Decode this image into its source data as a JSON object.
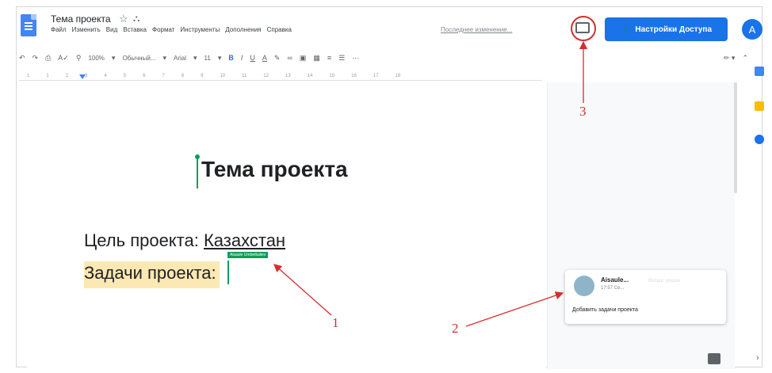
{
  "header": {
    "doc_title": "Тема проекта",
    "menu": [
      "Файл",
      "Изменить",
      "Вид",
      "Вставка",
      "Формат",
      "Инструменты",
      "Дополнения",
      "Справка"
    ],
    "last_edit": "Последнее изменение...",
    "share_label": "Настройки Доступа",
    "avatar_initial": "A"
  },
  "toolbar": {
    "zoom": "100%",
    "style": "Обычный...",
    "font": "Arial",
    "size": "11"
  },
  "ruler": [
    "1",
    "1",
    "2",
    "3",
    "4",
    "5",
    "6",
    "7",
    "8",
    "9",
    "10",
    "11",
    "12",
    "13",
    "14",
    "15",
    "16",
    "17",
    "18"
  ],
  "document": {
    "heading": "Тема проекта",
    "line1_prefix": "Цель проекта: ",
    "line1_word": "Казахстан",
    "line2": "Задачи проекта:",
    "collab_flag": "Aisaule Umbetkaliev"
  },
  "comment": {
    "author": "Aisaule...",
    "time": "17:57 Се...",
    "resolve": "Вопрос решен",
    "text": "Добавить задачи проекта"
  },
  "annotations": {
    "n1": "1",
    "n2": "2",
    "n3": "3"
  },
  "colors": {
    "accent": "#1a73e8",
    "collab": "#0f9d58",
    "annotation": "#d32f2f",
    "highlight": "#fce8b2"
  }
}
